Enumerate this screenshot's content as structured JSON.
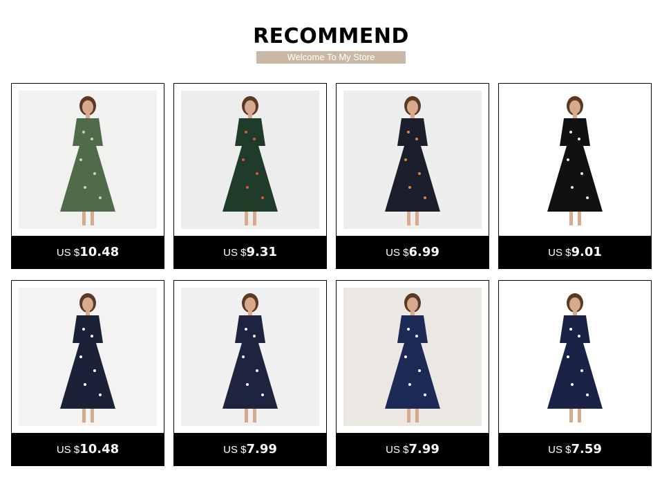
{
  "header": {
    "title": "RECOMMEND",
    "subtitle": "Welcome To My Store",
    "subtitle_color": "#c9b8a6"
  },
  "products": [
    {
      "currency": "US $",
      "price": "10.48",
      "image": "green-polka-dot-wrap-dress-photo",
      "dress_color": "#4f6b4a",
      "pattern_color": "#c9d3b8",
      "background": "#f1f1f0"
    },
    {
      "currency": "US $",
      "price": "9.31",
      "image": "tropical-print-wrap-dress-photo",
      "dress_color": "#1f3b2a",
      "pattern_color": "#e0563a",
      "background": "#ededed"
    },
    {
      "currency": "US $",
      "price": "6.99",
      "image": "navy-floral-shift-dress-photo",
      "dress_color": "#1b1f2b",
      "pattern_color": "#d98a3a",
      "background": "#eeeeee"
    },
    {
      "currency": "US $",
      "price": "9.01",
      "image": "black-floral-ruffle-dress-photo",
      "dress_color": "#111111",
      "pattern_color": "#e8e8e8",
      "background": "#ffffff"
    },
    {
      "currency": "US $",
      "price": "10.48",
      "image": "navy-striped-shirt-dress-photo",
      "dress_color": "#1b2238",
      "pattern_color": "#ffffff",
      "background": "#f3f3f3"
    },
    {
      "currency": "US $",
      "price": "7.99",
      "image": "navy-dot-ruffle-sleeve-dress-photo",
      "dress_color": "#1e2440",
      "pattern_color": "#f2f2f2",
      "background": "#f0f0f0"
    },
    {
      "currency": "US $",
      "price": "7.99",
      "image": "navy-dot-v-neck-dress-photo",
      "dress_color": "#1d2a55",
      "pattern_color": "#ffffff",
      "background": "#ebe7e2"
    },
    {
      "currency": "US $",
      "price": "7.59",
      "image": "navy-big-dot-sleeveless-dress-photo",
      "dress_color": "#1a2346",
      "pattern_color": "#ffffff",
      "background": "#ffffff"
    }
  ]
}
